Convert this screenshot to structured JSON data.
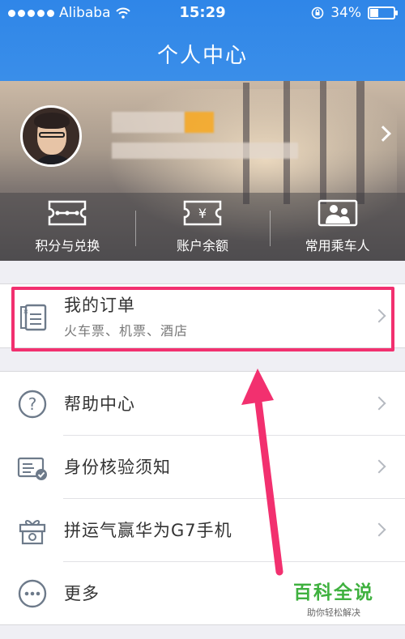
{
  "status_bar": {
    "carrier": "Alibaba",
    "time": "15:29",
    "battery": "34%",
    "battery_level": 0.34
  },
  "header": {
    "title": "个人中心"
  },
  "profile": {
    "actions": [
      {
        "label": "积分与兑换",
        "icon": "ticket-icon"
      },
      {
        "label": "账户余额",
        "icon": "yen-ticket-icon"
      },
      {
        "label": "常用乘车人",
        "icon": "passengers-icon"
      }
    ]
  },
  "orders": {
    "label": "我的订单",
    "sub": "火车票、机票、酒店",
    "icon": "order-receipt-icon"
  },
  "menu": [
    {
      "label": "帮助中心",
      "icon": "help-icon"
    },
    {
      "label": "身份核验须知",
      "icon": "id-card-icon"
    },
    {
      "label": "拼运气赢华为G7手机",
      "icon": "gift-icon"
    },
    {
      "label": "更多",
      "icon": "more-icon"
    }
  ],
  "watermark": {
    "title": "百科全说",
    "subtitle": "助你轻松解决"
  },
  "colors": {
    "nav": "#3a8ee9",
    "highlight": "#f2306f",
    "watermark": "#3fb13f"
  }
}
